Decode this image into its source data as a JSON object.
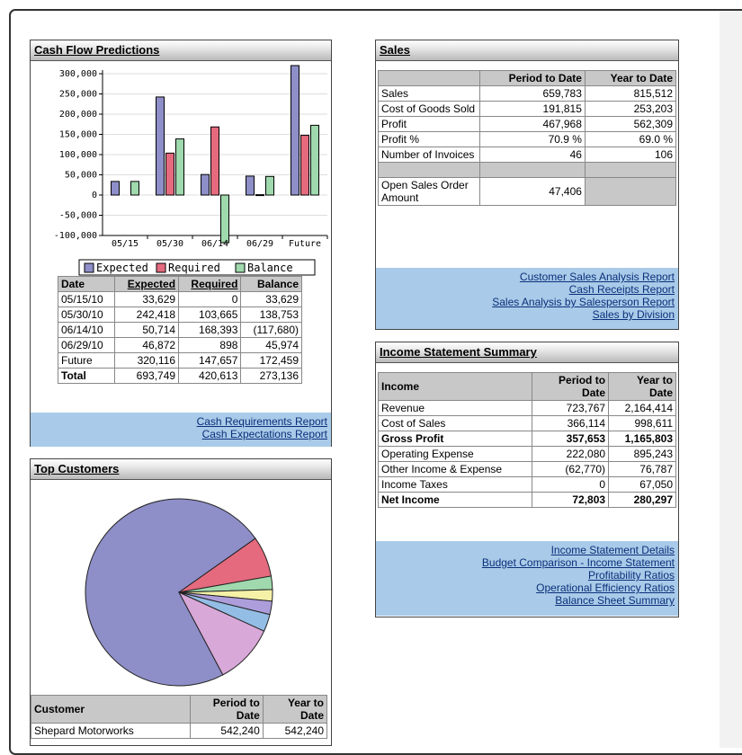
{
  "cash_flow": {
    "title": "Cash Flow Predictions",
    "chart_data": {
      "type": "bar",
      "categories": [
        "05/15",
        "05/30",
        "06/14",
        "06/29",
        "Future"
      ],
      "series": [
        {
          "name": "Expected",
          "color": "#8e8ec8",
          "values": [
            33629,
            242418,
            50714,
            46872,
            320116
          ]
        },
        {
          "name": "Required",
          "color": "#e56a7e",
          "values": [
            0,
            103665,
            168393,
            898,
            147657
          ]
        },
        {
          "name": "Balance",
          "color": "#9fd9ad",
          "values": [
            33629,
            138753,
            -117680,
            45974,
            172459
          ]
        }
      ],
      "yticks": [
        "300,000",
        "250,000",
        "200,000",
        "150,000",
        "100,000",
        "50,000",
        "0",
        "-50,000",
        "-100,000"
      ],
      "ylim": [
        -100000,
        300000
      ],
      "legend": [
        "Expected",
        "Required",
        "Balance"
      ]
    },
    "table": {
      "headers": [
        "Date",
        "Expected",
        "Required",
        "Balance"
      ],
      "rows": [
        [
          "05/15/10",
          "33,629",
          "0",
          "33,629"
        ],
        [
          "05/30/10",
          "242,418",
          "103,665",
          "138,753"
        ],
        [
          "06/14/10",
          "50,714",
          "168,393",
          "(117,680)"
        ],
        [
          "06/29/10",
          "46,872",
          "898",
          "45,974"
        ],
        [
          "Future",
          "320,116",
          "147,657",
          "172,459"
        ],
        [
          "Total",
          "693,749",
          "420,613",
          "273,136"
        ]
      ]
    },
    "links": [
      "Cash Requirements Report",
      "Cash Expectations Report"
    ]
  },
  "top_customers": {
    "title": "Top Customers",
    "chart_data": {
      "type": "pie",
      "slices": [
        {
          "color": "#8e8ec8",
          "value": 73
        },
        {
          "color": "#e56a7e",
          "value": 7
        },
        {
          "color": "#9fd9ad",
          "value": 2.3
        },
        {
          "color": "#f5f2a8",
          "value": 2
        },
        {
          "color": "#ad9edb",
          "value": 2.3
        },
        {
          "color": "#94bde6",
          "value": 3
        },
        {
          "color": "#d8a8d8",
          "value": 10.4
        }
      ]
    },
    "table": {
      "headers": [
        "Customer",
        "Period to Date",
        "Year to Date"
      ],
      "first_row": [
        "Shepard Motorworks",
        "542,240",
        "542,240"
      ]
    }
  },
  "sales": {
    "title": "Sales",
    "headers": [
      "",
      "Period to Date",
      "Year to Date"
    ],
    "rows": [
      [
        "Sales",
        "659,783",
        "815,512"
      ],
      [
        "Cost of Goods Sold",
        "191,815",
        "253,203"
      ],
      [
        "Profit",
        "467,968",
        "562,309"
      ],
      [
        "Profit %",
        "70.9 %",
        "69.0 %"
      ],
      [
        "Number of Invoices",
        "46",
        "106"
      ]
    ],
    "open_orders": [
      "Open Sales Order Amount",
      "47,406"
    ],
    "links": [
      "Customer Sales Analysis Report",
      "Cash Receipts Report",
      "Sales Analysis by Salesperson Report",
      "Sales by Division"
    ]
  },
  "income": {
    "title": "Income Statement Summary",
    "headers": [
      "Income",
      "Period to Date",
      "Year to Date"
    ],
    "rows": [
      [
        "Revenue",
        "723,767",
        "2,164,414"
      ],
      [
        "Cost of Sales",
        "366,114",
        "998,611"
      ],
      [
        "Gross Profit",
        "357,653",
        "1,165,803"
      ],
      [
        "Operating Expense",
        "222,080",
        "895,243"
      ],
      [
        "Other Income & Expense",
        "(62,770)",
        "76,787"
      ],
      [
        "Income Taxes",
        "0",
        "67,050"
      ],
      [
        "Net Income",
        "72,803",
        "280,297"
      ]
    ],
    "links": [
      "Income Statement Details",
      "Budget Comparison - Income Statement",
      "Profitability Ratios",
      "Operational Efficiency Ratios",
      "Balance Sheet Summary"
    ]
  }
}
